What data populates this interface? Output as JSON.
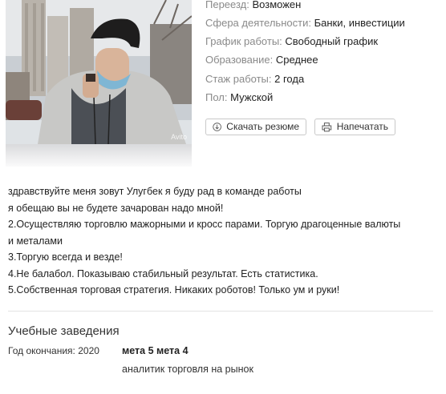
{
  "profile": {
    "photo_watermark": "Avito"
  },
  "details": [
    {
      "label": "Переезд:",
      "value": "Возможен"
    },
    {
      "label": "Сфера деятельности:",
      "value": "Банки, инвестиции"
    },
    {
      "label": "График работы:",
      "value": "Свободный график"
    },
    {
      "label": "Образование:",
      "value": "Среднее"
    },
    {
      "label": "Стаж работы:",
      "value": "2 года"
    },
    {
      "label": "Пол:",
      "value": "Мужской"
    }
  ],
  "actions": {
    "download_label": "Скачать резюме",
    "download_icon": "download-icon",
    "print_label": "Напечатать",
    "print_icon": "printer-icon"
  },
  "description": [
    "здравствуйте меня зовут Улугбек я буду рад в команде работы",
    "я обещаю вы не будете зачарован надо мной!",
    "2.Осуществляю торговлю мажорными и кросс парами. Торгую драгоценные валюты",
    "и металами",
    "3.Торгую всегда и везде!",
    "4.Не балабол. Показываю стабильный результат. Есть статистика.",
    "5.Собственная торговая стратегия. Никаких роботов! Только ум и руки!"
  ],
  "education": {
    "title": "Учебные заведения",
    "year_label": "Год окончания: 2020",
    "institution": "мета 5 мета 4",
    "specialty": "аналитик торговля на рынок"
  }
}
